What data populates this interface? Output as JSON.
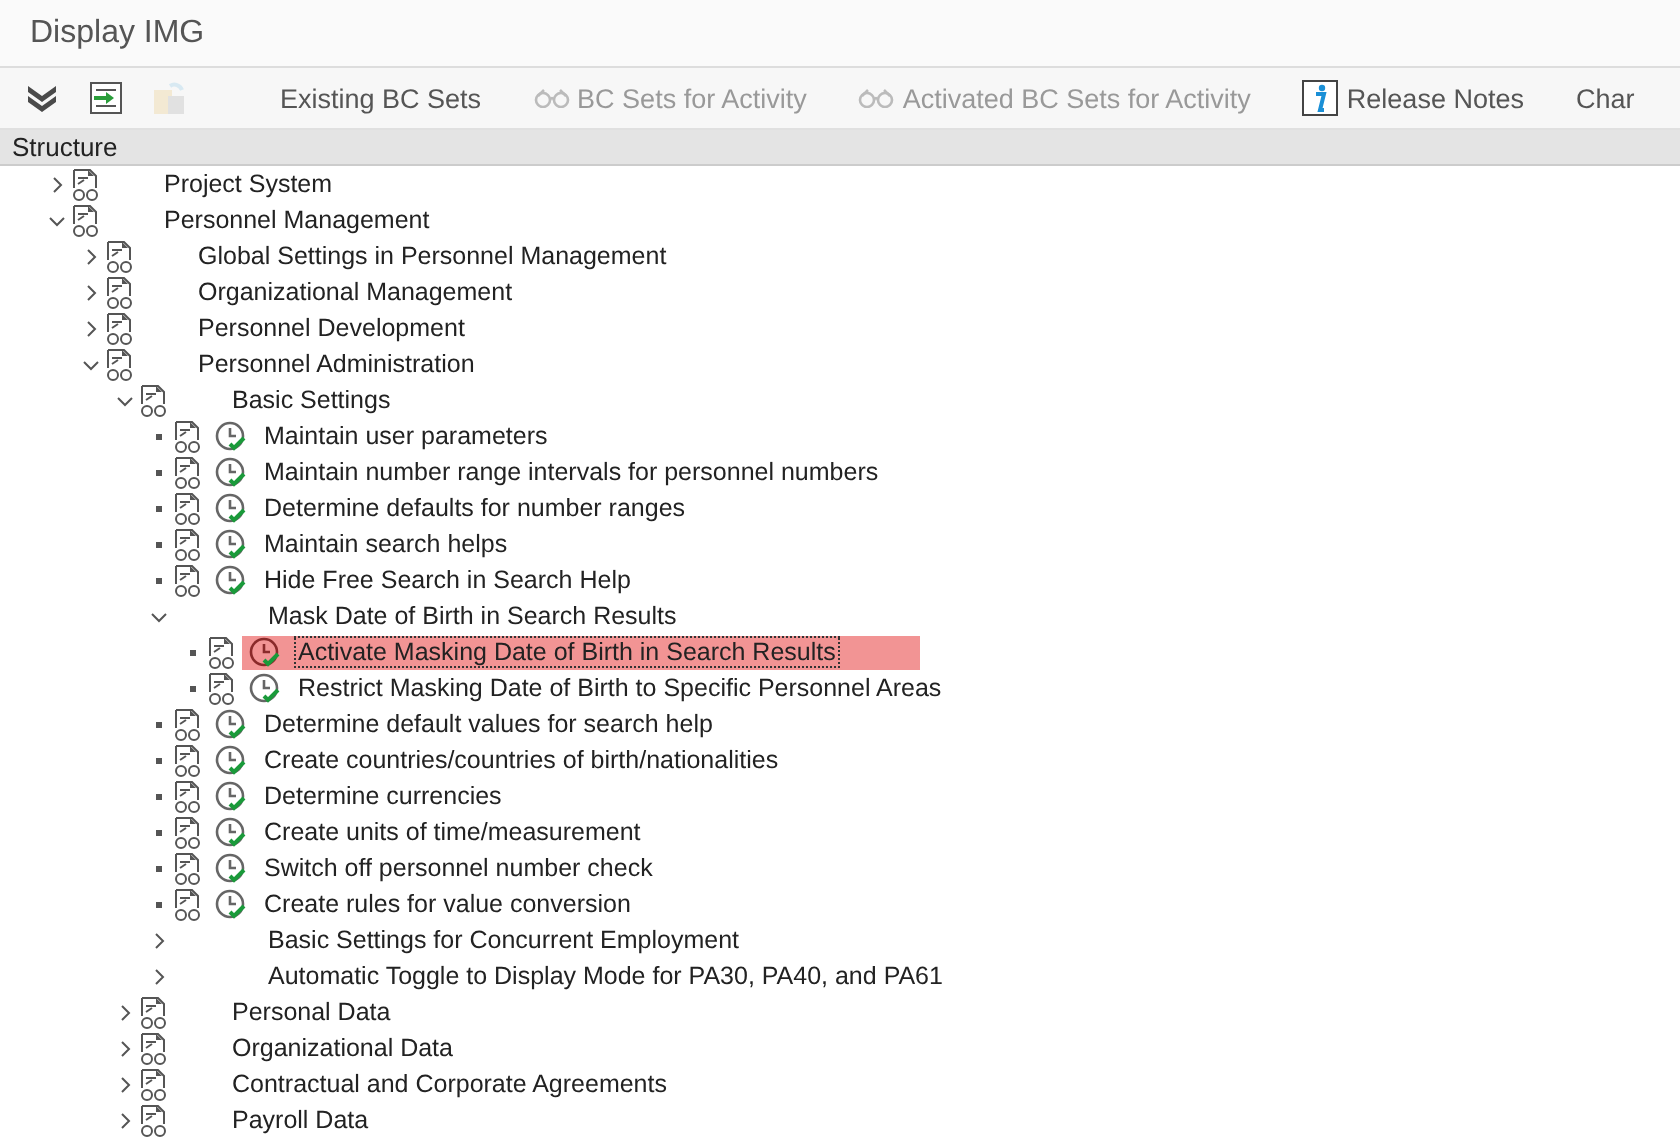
{
  "window": {
    "title": "Display IMG"
  },
  "toolbar": {
    "icon_buttons": [
      {
        "kind": "collapse",
        "disabled": false
      },
      {
        "kind": "transfer",
        "disabled": false
      },
      {
        "kind": "paste",
        "disabled": true
      }
    ],
    "buttons": [
      {
        "label": "Existing BC Sets",
        "kind": "text",
        "disabled": false
      },
      {
        "label": "BC Sets for Activity",
        "kind": "glasses",
        "disabled": true
      },
      {
        "label": "Activated BC Sets for Activity",
        "kind": "glasses",
        "disabled": true
      },
      {
        "label": "Release Notes",
        "kind": "info",
        "disabled": false
      },
      {
        "label": "Char",
        "kind": "text",
        "disabled": false
      }
    ]
  },
  "tree": {
    "header": "Structure",
    "nodes": [
      {
        "label": "Project System",
        "kind": "folder",
        "expanded": false,
        "selected": false
      },
      {
        "label": "Personnel Management",
        "kind": "folder",
        "expanded": true,
        "selected": false,
        "children": [
          {
            "label": "Global Settings in Personnel Management",
            "kind": "folder",
            "expanded": false,
            "selected": false
          },
          {
            "label": "Organizational Management",
            "kind": "folder",
            "expanded": false,
            "selected": false
          },
          {
            "label": "Personnel Development",
            "kind": "folder",
            "expanded": false,
            "selected": false
          },
          {
            "label": "Personnel Administration",
            "kind": "folder",
            "expanded": true,
            "selected": false,
            "children": [
              {
                "label": "Basic Settings",
                "kind": "folder",
                "expanded": true,
                "selected": false,
                "children": [
                  {
                    "label": "Maintain user parameters",
                    "kind": "activity",
                    "selected": false
                  },
                  {
                    "label": "Maintain number range intervals for personnel numbers",
                    "kind": "activity",
                    "selected": false
                  },
                  {
                    "label": "Determine defaults for number ranges",
                    "kind": "activity",
                    "selected": false
                  },
                  {
                    "label": "Maintain search helps",
                    "kind": "activity",
                    "selected": false
                  },
                  {
                    "label": "Hide Free Search in Search Help",
                    "kind": "activity",
                    "selected": false
                  },
                  {
                    "label": "Mask Date of Birth in Search Results",
                    "kind": "plain",
                    "expanded": true,
                    "selected": false,
                    "children": [
                      {
                        "label": "Activate Masking Date of Birth in Search Results",
                        "kind": "activity",
                        "selected": true
                      },
                      {
                        "label": "Restrict Masking Date of Birth to Specific Personnel Areas",
                        "kind": "activity",
                        "selected": false
                      }
                    ]
                  },
                  {
                    "label": "Determine default values for search help",
                    "kind": "activity",
                    "selected": false
                  },
                  {
                    "label": "Create countries/countries of birth/nationalities",
                    "kind": "activity",
                    "selected": false
                  },
                  {
                    "label": "Determine currencies",
                    "kind": "activity",
                    "selected": false
                  },
                  {
                    "label": "Create units of time/measurement",
                    "kind": "activity",
                    "selected": false
                  },
                  {
                    "label": "Switch off personnel number check",
                    "kind": "activity",
                    "selected": false
                  },
                  {
                    "label": "Create rules for value conversion",
                    "kind": "activity",
                    "selected": false
                  },
                  {
                    "label": "Basic Settings for Concurrent Employment",
                    "kind": "plain",
                    "expanded": false,
                    "selected": false
                  },
                  {
                    "label": "Automatic Toggle to Display Mode for PA30, PA40, and PA61",
                    "kind": "plain",
                    "expanded": false,
                    "selected": false
                  }
                ]
              },
              {
                "label": "Personal Data",
                "kind": "folder",
                "expanded": false,
                "selected": false
              },
              {
                "label": "Organizational Data",
                "kind": "folder",
                "expanded": false,
                "selected": false
              },
              {
                "label": "Contractual and Corporate Agreements",
                "kind": "folder",
                "expanded": false,
                "selected": false
              },
              {
                "label": "Payroll Data",
                "kind": "folder",
                "expanded": false,
                "selected": false
              }
            ]
          }
        ]
      }
    ]
  }
}
